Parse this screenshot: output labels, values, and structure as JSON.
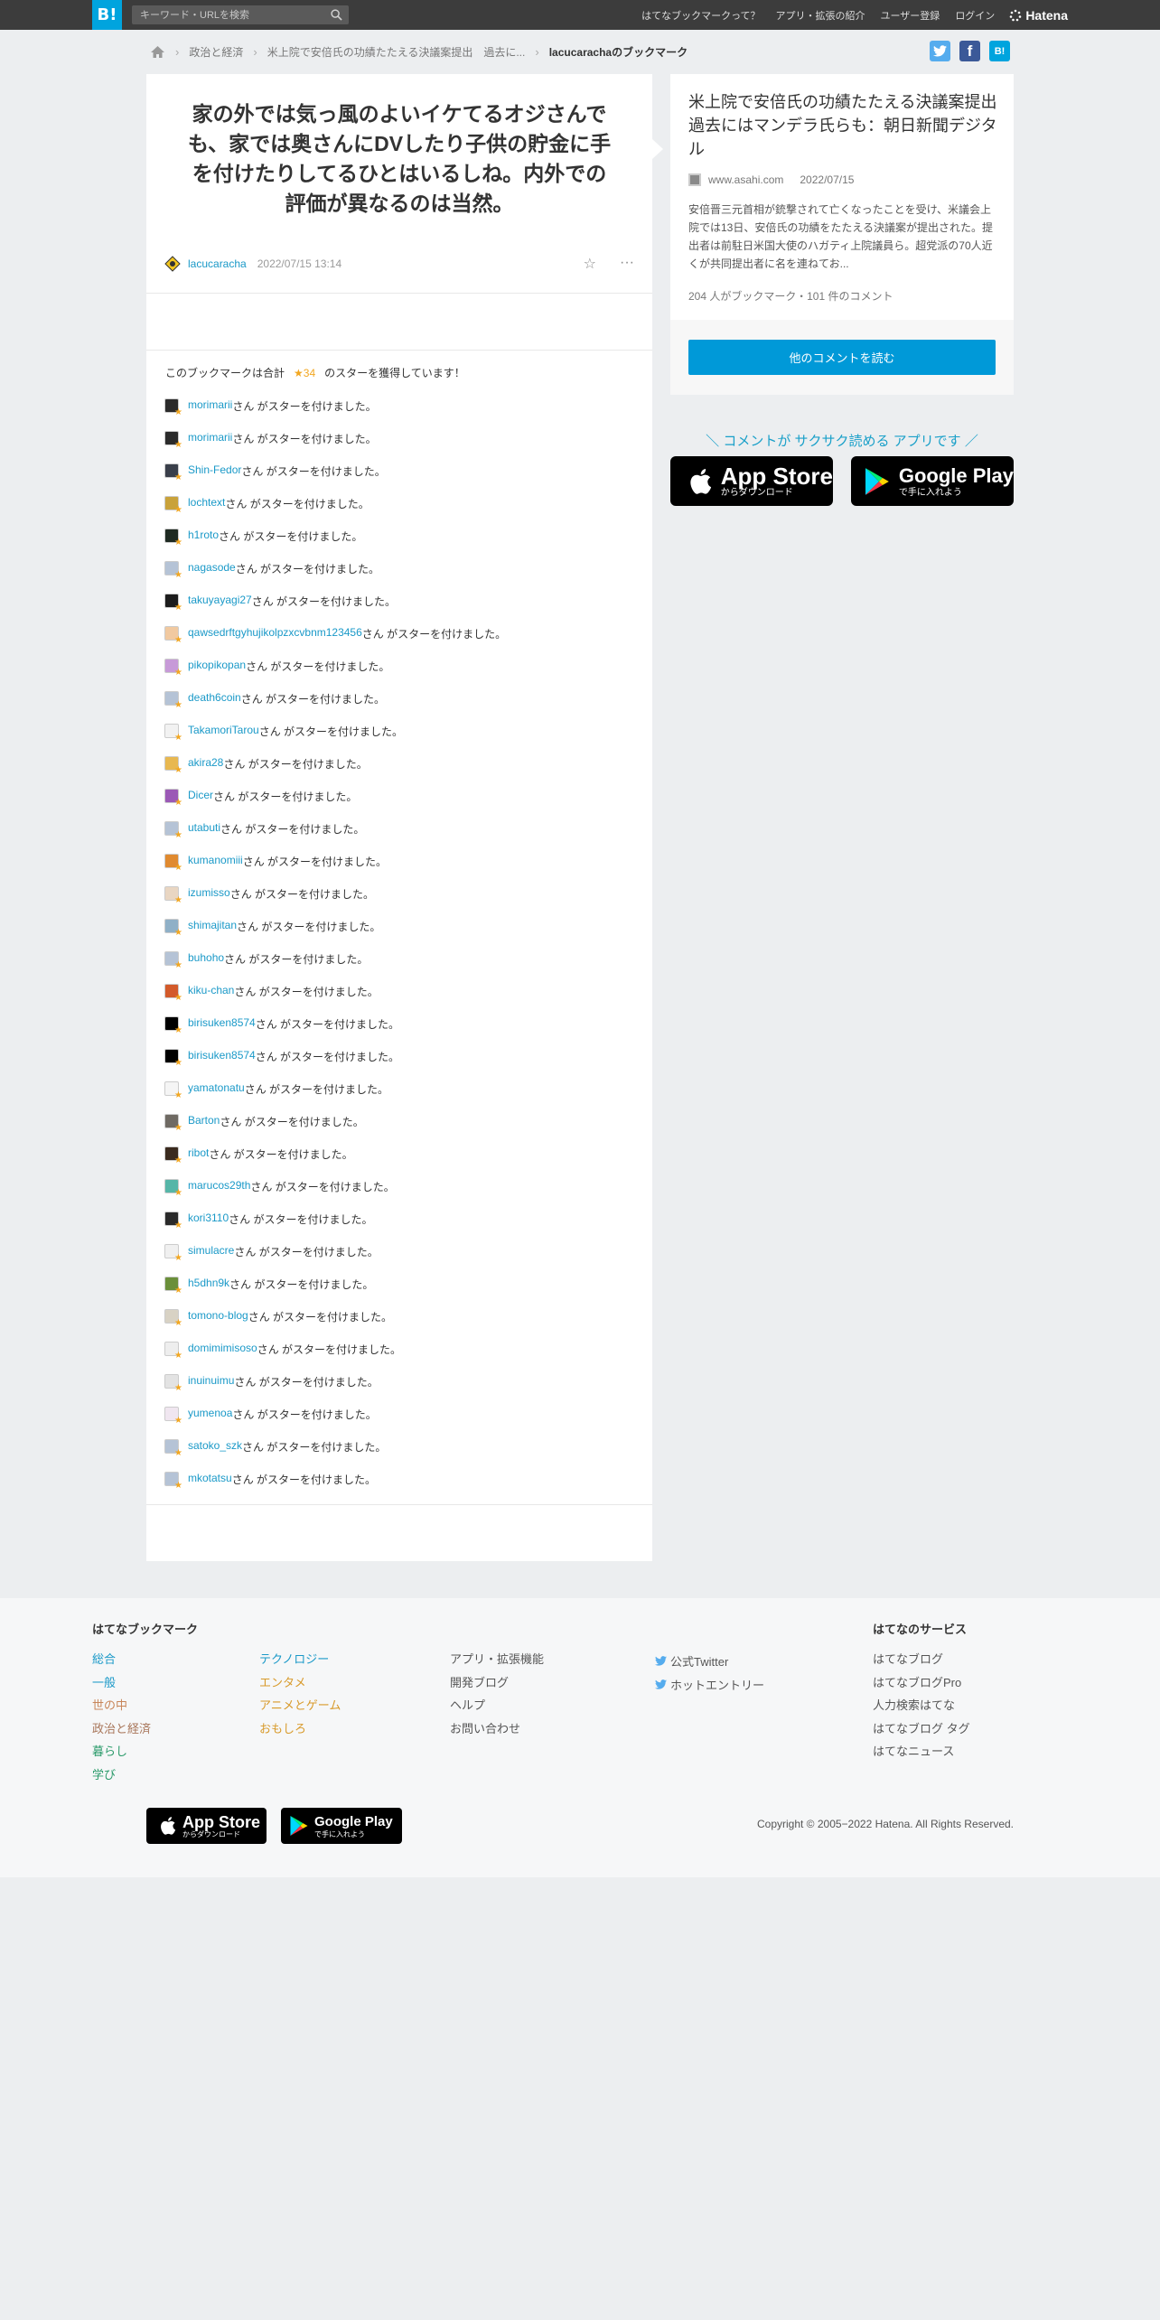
{
  "header": {
    "logo": "B!",
    "search_placeholder": "キーワード・URLを検索",
    "nav": [
      "はてなブックマークって？",
      "アプリ・拡張の紹介",
      "ユーザー登録",
      "ログイン"
    ],
    "brand": "Hatena"
  },
  "breadcrumb": {
    "items": [
      "政治と経済",
      "米上院で安倍氏の功績たたえる決議案提出　過去に..."
    ],
    "current": "lacucarachaのブックマーク"
  },
  "bookmark": {
    "comment": "家の外では気っ風のよいイケてるオジさんでも、家では奥さんにDVしたり子供の貯金に手を付けたりしてるひとはいるしね。内外での評価が異なるのは当然。",
    "user": "lacucaracha",
    "date": "2022/07/15 13:14"
  },
  "stars": {
    "summary_prefix": "このブックマークは合計",
    "count": "★34",
    "summary_suffix": "のスターを獲得しています！",
    "suffix_text": "さん がスターを付けました。",
    "users": [
      {
        "name": "morimarii",
        "color": "#2b2b2b"
      },
      {
        "name": "morimarii",
        "color": "#2b2b2b"
      },
      {
        "name": "Shin-Fedor",
        "color": "#3a3f4a"
      },
      {
        "name": "lochtext",
        "color": "#c9a23a"
      },
      {
        "name": "h1roto",
        "color": "#1e2a22"
      },
      {
        "name": "nagasode",
        "color": "#b5c3d6"
      },
      {
        "name": "takuyayagi27",
        "color": "#1c1c1c"
      },
      {
        "name": "qawsedrftgyhujikolpzxcvbnm123456",
        "color": "#f1c9a0"
      },
      {
        "name": "pikopikopan",
        "color": "#c79ad8"
      },
      {
        "name": "death6coin",
        "color": "#b5c3d6"
      },
      {
        "name": "TakamoriTarou",
        "color": "#f2f2f2"
      },
      {
        "name": "akira28",
        "color": "#e8b850"
      },
      {
        "name": "Dicer",
        "color": "#9b59b6"
      },
      {
        "name": "utabuti",
        "color": "#b5c3d6"
      },
      {
        "name": "kumanomiii",
        "color": "#e08a2f"
      },
      {
        "name": "izumisso",
        "color": "#e9d6c2"
      },
      {
        "name": "shimajitan",
        "color": "#8fb0c7"
      },
      {
        "name": "buhoho",
        "color": "#b5c3d6"
      },
      {
        "name": "kiku-chan",
        "color": "#d35a2a"
      },
      {
        "name": "birisuken8574",
        "color": "#000000"
      },
      {
        "name": "birisuken8574",
        "color": "#000000"
      },
      {
        "name": "yamatonatu",
        "color": "#f5f5f5"
      },
      {
        "name": "Barton",
        "color": "#6f6a63"
      },
      {
        "name": "ribot",
        "color": "#3a2a1e"
      },
      {
        "name": "marucos29th",
        "color": "#56b6a8"
      },
      {
        "name": "kori3110",
        "color": "#2a2a2a"
      },
      {
        "name": "simulacre",
        "color": "#f0f0f0"
      },
      {
        "name": "h5dhn9k",
        "color": "#6a8f3a"
      },
      {
        "name": "tomono-blog",
        "color": "#d8d2c4"
      },
      {
        "name": "domimimisoso",
        "color": "#eeeeee"
      },
      {
        "name": "inuinuimu",
        "color": "#e3e3e3"
      },
      {
        "name": "yumenoa",
        "color": "#f0e6f0"
      },
      {
        "name": "satoko_szk",
        "color": "#b5c3d6"
      },
      {
        "name": "mkotatsu",
        "color": "#b5c3d6"
      }
    ]
  },
  "entry": {
    "title": "米上院で安倍氏の功績たたえる決議案提出　過去にはマンデラ氏らも：朝日新聞デジタル",
    "domain": "www.asahi.com",
    "date": "2022/07/15",
    "description": "安倍晋三元首相が銃撃されて亡くなったことを受け、米議会上院では13日、安倍氏の功績をたたえる決議案が提出された。提出者は前駐日米国大使のハガティ上院議員ら。超党派の70人近くが共同提出者に名を連ねてお...",
    "count": "204 人がブックマーク・101 件のコメント",
    "more_button": "他のコメントを読む"
  },
  "promo": {
    "text": "＼ コメントが サクサク読める アプリです ／",
    "appstore_big": "App Store",
    "appstore_small": "からダウンロード",
    "googleplay_big": "Google Play",
    "googleplay_small": "で手に入れよう"
  },
  "footer": {
    "bookmark_head": "はてなブックマーク",
    "col1": [
      "総合",
      "一般",
      "世の中",
      "政治と経済",
      "暮らし",
      "学び"
    ],
    "col2": [
      "テクノロジー",
      "エンタメ",
      "アニメとゲーム",
      "おもしろ"
    ],
    "col3": [
      "アプリ・拡張機能",
      "開発ブログ",
      "ヘルプ",
      "お問い合わせ"
    ],
    "col4": [
      "公式Twitter",
      "ホットエントリー"
    ],
    "services_head": "はてなのサービス",
    "services": [
      "はてなブログ",
      "はてなブログPro",
      "人力検索はてな",
      "はてなブログ タグ",
      "はてなニュース"
    ],
    "copyright": "Copyright © 2005−2022 Hatena. All Rights Reserved."
  },
  "colors": {
    "accent": "#00a4de",
    "link": "#1a99c8",
    "star": "#f2a721",
    "button": "#0099d8"
  }
}
